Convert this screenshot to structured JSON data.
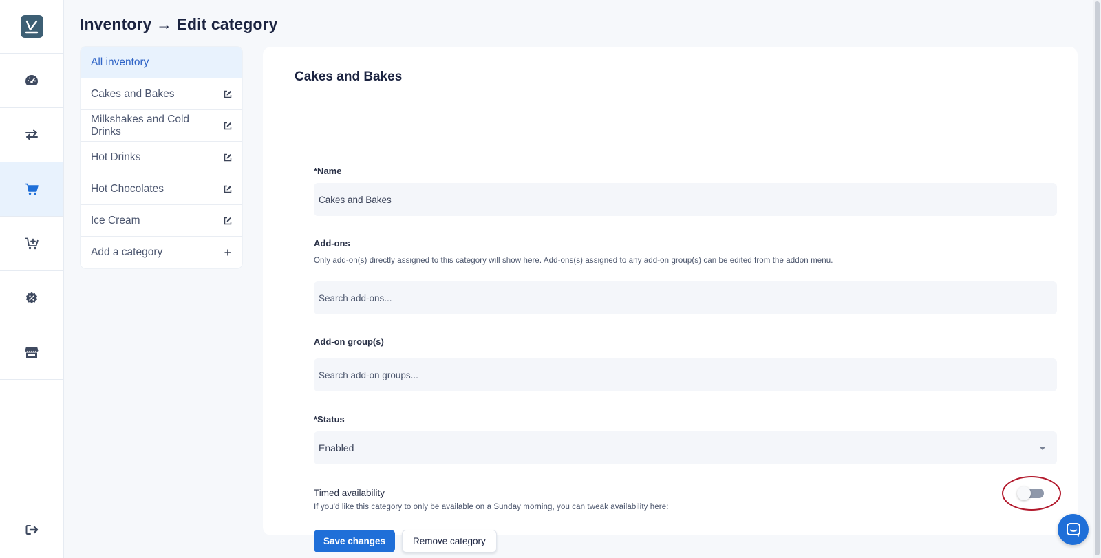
{
  "page": {
    "title": "Inventory → Edit category"
  },
  "rail": {
    "items": [
      {
        "icon": "dashboard-icon"
      },
      {
        "icon": "transfer-icon"
      },
      {
        "icon": "cart-icon",
        "active": true
      },
      {
        "icon": "cart-add-icon"
      },
      {
        "icon": "discount-icon"
      },
      {
        "icon": "store-icon"
      }
    ],
    "logout_icon": "logout-icon"
  },
  "categories": {
    "all_label": "All inventory",
    "items": [
      {
        "label": "Cakes and Bakes"
      },
      {
        "label": "Milkshakes and Cold Drinks"
      },
      {
        "label": "Hot Drinks"
      },
      {
        "label": "Hot Chocolates"
      },
      {
        "label": "Ice Cream"
      }
    ],
    "add_label": "Add a category"
  },
  "form": {
    "heading": "Cakes and Bakes",
    "name_label": "*Name",
    "name_value": "Cakes and Bakes",
    "addons_label": "Add-ons",
    "addons_hint": "Only add-on(s) directly assigned to this category will show here. Add-ons(s) assigned to any add-on group(s) can be edited from the addon menu.",
    "addons_placeholder": "Search add-ons...",
    "addon_groups_label": "Add-on group(s)",
    "addon_groups_placeholder": "Search add-on groups...",
    "status_label": "*Status",
    "status_value": "Enabled",
    "timed_label": "Timed availability",
    "timed_hint": "If you'd like this category to only be available on a Sunday morning, you can tweak availability here:",
    "timed_enabled": false,
    "save_label": "Save changes",
    "remove_label": "Remove category"
  },
  "colors": {
    "accent": "#1f6fd8",
    "highlight_circle": "#b2182b"
  }
}
